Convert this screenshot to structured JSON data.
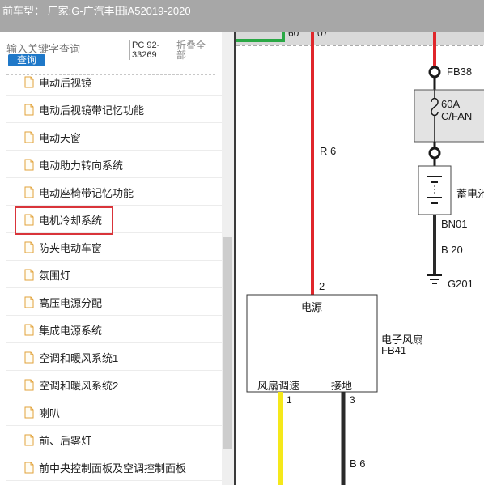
{
  "header": {
    "title": "前车型：  厂家:G-广汽丰田iA52019-2020"
  },
  "search": {
    "placeholder": "输入关键字查询",
    "button_label": "查询",
    "pc_code": "PC 92-33269",
    "collapse_label": "折叠全部"
  },
  "tree": {
    "items": [
      {
        "label": "电动后视镜"
      },
      {
        "label": "电动后视镜带记忆功能"
      },
      {
        "label": "电动天窗"
      },
      {
        "label": "电动助力转向系统"
      },
      {
        "label": "电动座椅带记忆功能"
      },
      {
        "label": "电机冷却系统",
        "highlighted": true
      },
      {
        "label": "防夹电动车窗"
      },
      {
        "label": "氛围灯"
      },
      {
        "label": "高压电源分配"
      },
      {
        "label": "集成电源系统"
      },
      {
        "label": "空调和暖风系统1"
      },
      {
        "label": "空调和暖风系统2"
      },
      {
        "label": "喇叭"
      },
      {
        "label": "前、后雾灯"
      },
      {
        "label": "前中央控制面板及空调控制面板"
      }
    ]
  },
  "diagram": {
    "top_pin_left": "60",
    "top_pin_right": "07",
    "fuse_box_label": "FB38",
    "fuse_rating": "60A",
    "fuse_name": "C/FAN",
    "battery_label": "蓄电池",
    "wire_r6": "R 6",
    "connector_bn01": "BN01",
    "wire_b20": "B 20",
    "ground_g201": "G201",
    "pin_2": "2",
    "power_label": "电源",
    "component_name": "电子风扇",
    "component_code": "FB41",
    "fan_speed_label": "风扇调速",
    "ground_label": "接地",
    "pin_1": "1",
    "pin_3": "3",
    "wire_b6": "B 6",
    "colors": {
      "red_wire": "#e0262b",
      "black_wire": "#2a2a2a",
      "yellow_wire": "#f5e81a",
      "green_wire": "#2aa845",
      "fuse_fill": "#e3e3e3"
    }
  }
}
